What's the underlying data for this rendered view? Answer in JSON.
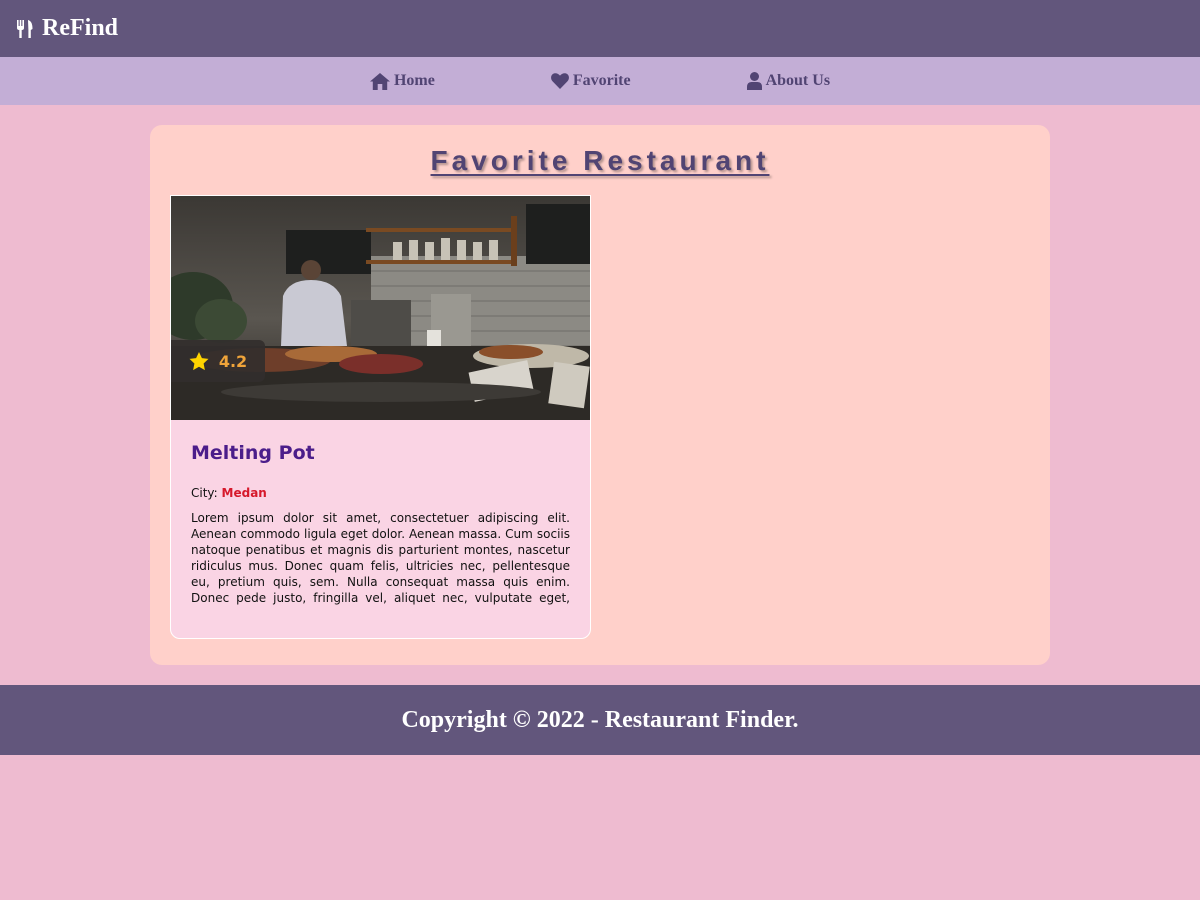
{
  "app_bar": {
    "brand_icon": "utensils-icon",
    "brand": "ReFind"
  },
  "nav": {
    "items": [
      {
        "icon": "home-icon",
        "label": "Home"
      },
      {
        "icon": "heart-icon",
        "label": "Favorite"
      },
      {
        "icon": "user-icon",
        "label": "About Us"
      }
    ]
  },
  "main": {
    "title": "Favorite Restaurant",
    "restaurants": [
      {
        "name": "Melting Pot",
        "rating": "4.2",
        "rating_icon": "star-icon",
        "city_label": "City:",
        "city": "Medan",
        "description": "Lorem ipsum dolor sit amet, consectetuer adipiscing elit. Aenean commodo ligula eget dolor. Aenean massa. Cum sociis natoque penatibus et magnis dis parturient montes, nascetur ridiculus mus. Donec quam felis, ultricies nec, pellentesque eu, pretium quis, sem. Nulla consequat massa quis enim. Donec pede justo, fringilla vel, aliquet nec, vulputate eget, arcu. In enim justo, rhoncus ut, imperdiet a, venenatis vitae, justo. Nullam dictum felis eu pede mollis pretium."
      }
    ]
  },
  "footer": {
    "copyright": "Copyright © 2022 - Restaurant Finder."
  },
  "colors": {
    "app_bar": "#62567c",
    "nav": "#c3aed6",
    "page_bg": "#eebbd0",
    "panel": "#ffd0ca",
    "card": "#fad4e4",
    "title": "#514473",
    "restaurant_name": "#4b1d8a",
    "city": "#d6192b",
    "rating": "#f0a43a",
    "star": "#ffd400"
  }
}
